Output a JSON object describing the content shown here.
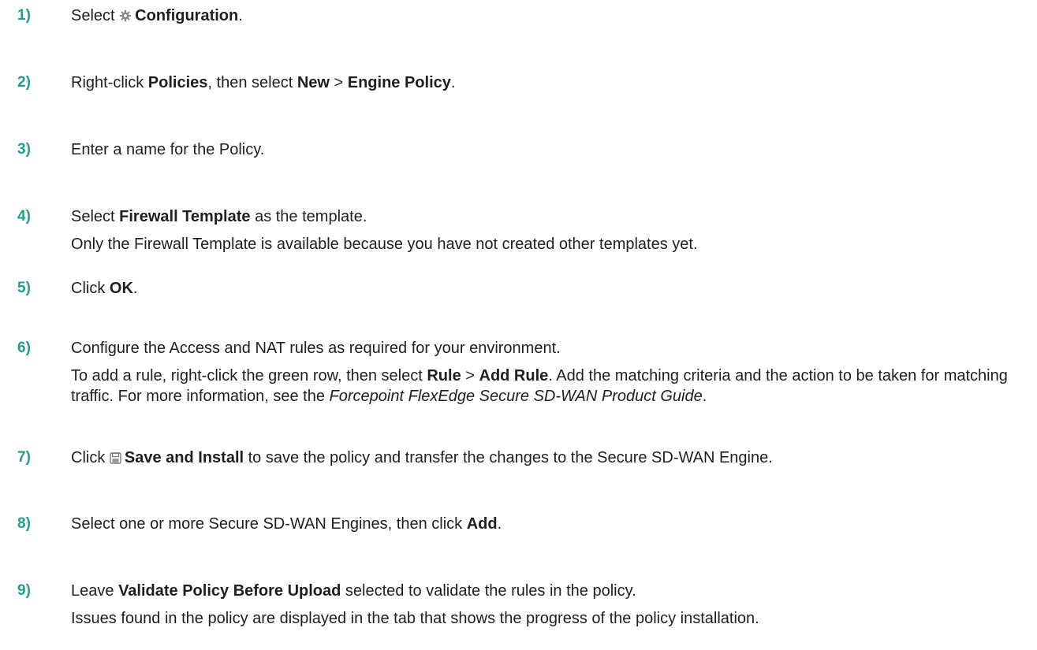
{
  "steps": [
    {
      "num": "1)",
      "pre": "Select ",
      "icon": "gear-icon",
      "b1": "Configuration",
      "post": "."
    },
    {
      "num": "2)",
      "pre": "Right-click ",
      "b1": "Policies",
      "mid1": ", then select ",
      "b2": "New",
      "mid2": " > ",
      "b3": "Engine Policy",
      "post": "."
    },
    {
      "num": "3)",
      "text": "Enter a name for the Policy."
    },
    {
      "num": "4)",
      "pre": "Select ",
      "b1": "Firewall Template",
      "post": " as the template.",
      "note": "Only the Firewall Template is available because you have not created other templates yet."
    },
    {
      "num": "5)",
      "pre": "Click ",
      "b1": "OK",
      "post": "."
    },
    {
      "num": "6)",
      "text": "Configure the Access and NAT rules as required for your environment.",
      "note_pre": "To add a rule, right-click the green row, then select ",
      "note_b1": "Rule",
      "note_mid": " > ",
      "note_b2": "Add Rule",
      "note_mid2": ". Add the matching criteria and the action to be taken for matching traffic. For more information, see the ",
      "note_i": "Forcepoint FlexEdge Secure SD-WAN Product Guide",
      "note_post": "."
    },
    {
      "num": "7)",
      "pre": "Click ",
      "icon": "save-icon",
      "b1": "Save and Install",
      "post": " to save the policy and transfer the changes to the Secure SD-WAN Engine."
    },
    {
      "num": "8)",
      "pre": "Select one or more Secure SD-WAN Engines, then click ",
      "b1": "Add",
      "post": "."
    },
    {
      "num": "9)",
      "pre": "Leave ",
      "b1": "Validate Policy Before Upload",
      "post": " selected to validate the rules in the policy.",
      "note": "Issues found in the policy are displayed in the tab that shows the progress of the policy installation."
    }
  ],
  "colors": {
    "step_number": "#1aa38c",
    "text": "#1f1f1f"
  }
}
